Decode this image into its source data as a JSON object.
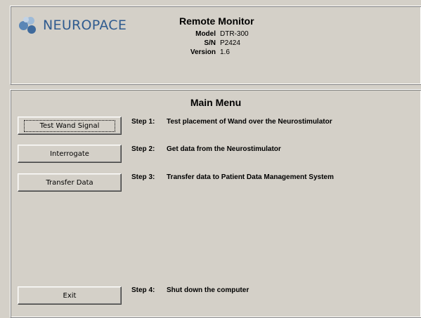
{
  "brand": {
    "name": "NEUROPACE"
  },
  "header": {
    "title": "Remote Monitor",
    "model_label": "Model",
    "model_value": "DTR-300",
    "sn_label": "S/N",
    "sn_value": "P2424",
    "version_label": "Version",
    "version_value": "1.6"
  },
  "menu": {
    "title": "Main Menu",
    "steps": [
      {
        "button": "Test Wand Signal",
        "step": "Step 1:",
        "desc": "Test placement of Wand over the Neurostimulator"
      },
      {
        "button": "Interrogate",
        "step": "Step 2:",
        "desc": "Get data from the Neurostimulator"
      },
      {
        "button": "Transfer Data",
        "step": "Step 3:",
        "desc": "Transfer data to Patient Data Management System"
      },
      {
        "button": "Exit",
        "step": "Step 4:",
        "desc": "Shut down the computer"
      }
    ]
  },
  "colors": {
    "background": "#d4d0c8",
    "brand": "#2f5b8f"
  }
}
